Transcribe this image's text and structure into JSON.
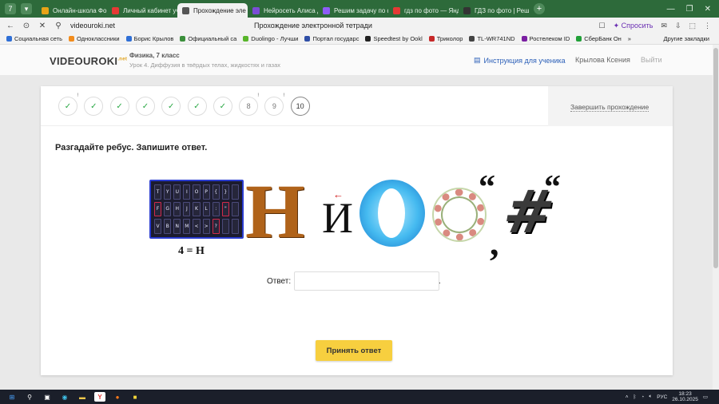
{
  "browser": {
    "tabs": [
      {
        "label": "Онлайн-школа Фок",
        "color": "#e8a317",
        "active": false
      },
      {
        "label": "Личный кабинет уч",
        "color": "#e53935",
        "active": false
      },
      {
        "label": "Прохождение эле",
        "color": "#555555",
        "active": true
      },
      {
        "label": "Нейросеть Алиса д",
        "color": "#7b4dd6",
        "active": false
      },
      {
        "label": "Решим задачу по ф",
        "color": "#8e5cf7",
        "active": false
      },
      {
        "label": "гдз по фото — Янд",
        "color": "#e53935",
        "active": false
      },
      {
        "label": "ГДЗ по фото | Реше",
        "color": "#333333",
        "active": false
      }
    ],
    "tab_counter": "7",
    "url": "videouroki.net",
    "page_title": "Прохождение электронной тетради",
    "ask_label": "Спросить",
    "bookmarks": [
      {
        "label": "Социальная сеть",
        "color": "#2f6fd6"
      },
      {
        "label": "Одноклассники",
        "color": "#f28c1d"
      },
      {
        "label": "Борис Крылов",
        "color": "#2f6fd6"
      },
      {
        "label": "Официальный са",
        "color": "#3b8f3b"
      },
      {
        "label": "Duolingo - Лучши",
        "color": "#58b52a"
      },
      {
        "label": "Портал государс",
        "color": "#2f4ea6"
      },
      {
        "label": "Speedtest by Ookl",
        "color": "#222222"
      },
      {
        "label": "Триколор",
        "color": "#c62828"
      },
      {
        "label": "TL-WR741ND",
        "color": "#444444"
      },
      {
        "label": "Ростелеком ID",
        "color": "#7b1fa2"
      },
      {
        "label": "СберБанк Он",
        "color": "#21a038"
      }
    ],
    "bookmarks_more": "»",
    "other_bookmarks": "Другие закладки"
  },
  "site": {
    "logo": "VIDEOUROKI",
    "logo_sup": ".net",
    "course": "Физика, 7 класс",
    "lesson": "Урок 4. Диффузия в твёрдых телах, жидкостях и газах",
    "instructions": "Инструкция для ученика",
    "user": "Крылова Ксения",
    "logout": "Выйти"
  },
  "steps": [
    {
      "label": "✓",
      "state": "done",
      "mark": "!"
    },
    {
      "label": "✓",
      "state": "done",
      "mark": ""
    },
    {
      "label": "✓",
      "state": "done",
      "mark": ""
    },
    {
      "label": "✓",
      "state": "done",
      "mark": ""
    },
    {
      "label": "✓",
      "state": "done",
      "mark": ""
    },
    {
      "label": "✓",
      "state": "done",
      "mark": ""
    },
    {
      "label": "✓",
      "state": "done",
      "mark": ""
    },
    {
      "label": "8",
      "state": "todo",
      "mark": "!"
    },
    {
      "label": "9",
      "state": "todo",
      "mark": "!"
    },
    {
      "label": "10",
      "state": "current",
      "mark": ""
    }
  ],
  "finish_label": "Завершить прохождение",
  "task": {
    "prompt": "Разгадайте ребус. Запишите ответ.",
    "rebus": {
      "keys_row1": [
        "T",
        "Y",
        "U",
        "I",
        "O",
        "P",
        "{",
        "}",
        ""
      ],
      "keys_row2": [
        "F",
        "G",
        "H",
        "J",
        "K",
        "L",
        ":",
        "\"",
        ""
      ],
      "keys_row3": [
        "V",
        "B",
        "N",
        "M",
        "<",
        ">",
        "?",
        "",
        ""
      ],
      "equation": "4 = Н",
      "big_letter": "Н",
      "small_letter": "И",
      "letter_o": "O",
      "hash": "#",
      "quote_open": "“",
      "quote_close": "“",
      "comma": ","
    },
    "answer_label": "Ответ:",
    "answer_value": "",
    "answer_placeholder": "",
    "answer_suffix": ".",
    "submit_label": "Принять ответ"
  },
  "taskbar": {
    "lang": "РУС",
    "time": "18:23",
    "date": "26.10.2025"
  }
}
